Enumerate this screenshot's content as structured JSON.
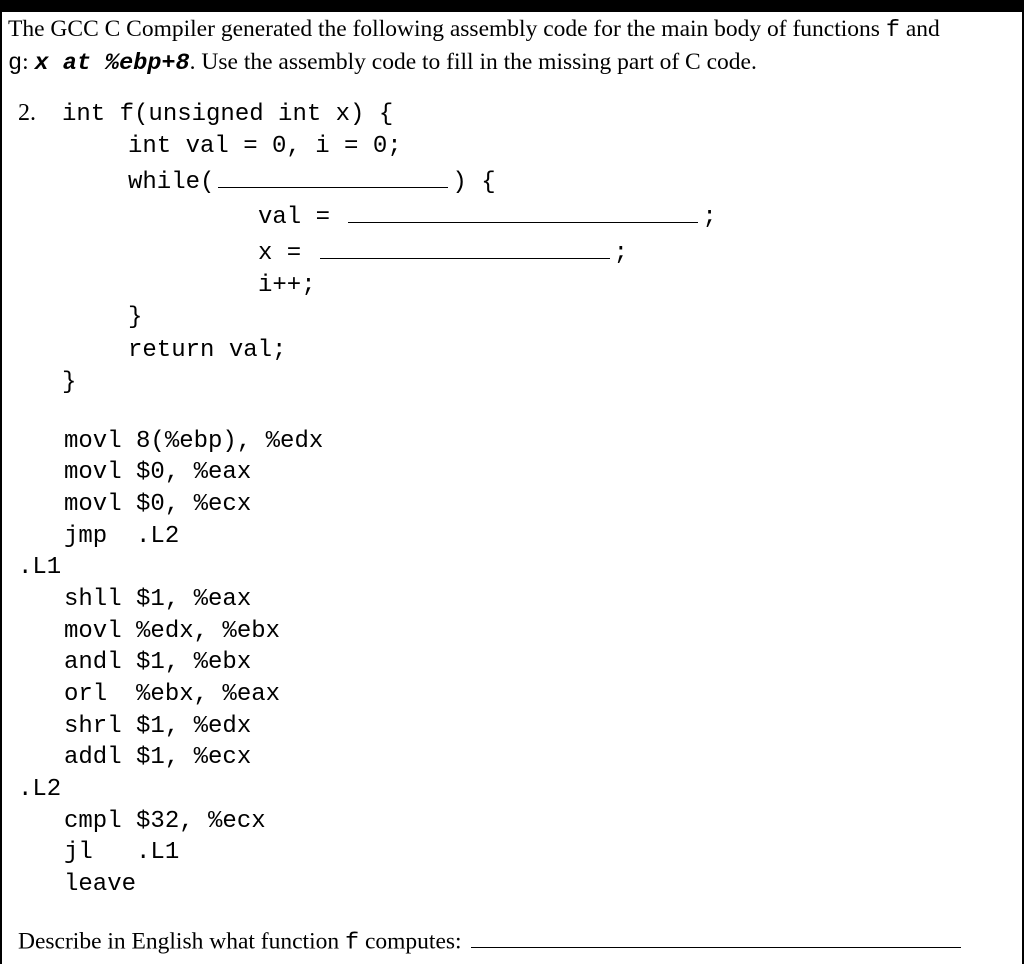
{
  "intro": {
    "part1": "The ",
    "gcc": "GCC",
    "part2": " C Compiler generated the following assembly code for the main body of functions ",
    "f": "f",
    "part3": " and ",
    "g": "g",
    "part4": ": ",
    "x": "x",
    "at": " at ",
    "ebp": "%ebp+8",
    "part5": ".   Use the assembly code to fill in the missing part of C code."
  },
  "question": {
    "number": "2.",
    "line1": "int f(unsigned int x) {",
    "line2": "int val = 0, i = 0;",
    "line3a": "while(",
    "line3b": ") {",
    "line4a": "val = ",
    "line4b": ";",
    "line5a": "x = ",
    "line5b": ";",
    "line6": "i++;",
    "line7": "}",
    "line8": "return val;",
    "line9": "}"
  },
  "asm": {
    "l01": "movl 8(%ebp), %edx",
    "l02": "movl $0, %eax",
    "l03": "movl $0, %ecx",
    "l04": "jmp  .L2",
    "lbl1": ".L1",
    "l05": "shll $1, %eax",
    "l06": "movl %edx, %ebx",
    "l07": "andl $1, %ebx",
    "l08": "orl  %ebx, %eax",
    "l09": "shrl $1, %edx",
    "l10": "addl $1, %ecx",
    "lbl2": ".L2",
    "l11": "cmpl $32, %ecx",
    "l12": "jl   .L1",
    "l13": "leave"
  },
  "describe": {
    "text": "Describe in English what function ",
    "f": "f",
    "text2": " computes: "
  }
}
